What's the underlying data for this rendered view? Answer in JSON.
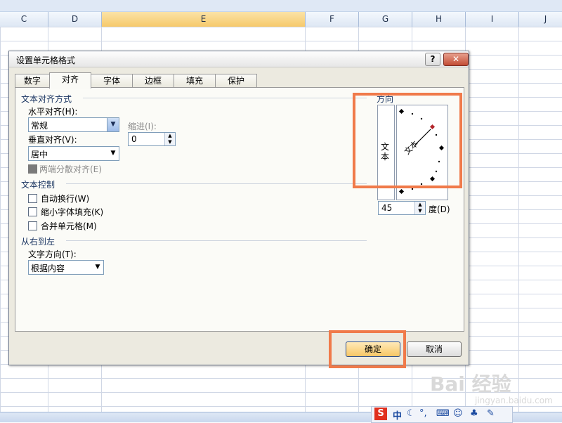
{
  "columns": [
    "C",
    "D",
    "E",
    "F",
    "G",
    "H",
    "I",
    "J"
  ],
  "dialog": {
    "title": "设置单元格格式",
    "help_glyph": "?",
    "close_glyph": "✕",
    "tabs": [
      "数字",
      "对齐",
      "字体",
      "边框",
      "填充",
      "保护"
    ],
    "active_tab": "对齐",
    "text_alignment": {
      "section_title": "文本对齐方式",
      "horizontal_label": "水平对齐(H):",
      "horizontal_value": "常规",
      "indent_label": "缩进(I):",
      "indent_value": "0",
      "vertical_label": "垂直对齐(V):",
      "vertical_value": "居中",
      "justify_distributed_label": "两端分散对齐(E)"
    },
    "text_control": {
      "section_title": "文本控制",
      "wrap_text_label": "自动换行(W)",
      "shrink_to_fit_label": "缩小字体填充(K)",
      "merge_cells_label": "合并单元格(M)"
    },
    "right_to_left": {
      "section_title": "从右到左",
      "text_direction_label": "文字方向(T):",
      "text_direction_value": "根据内容"
    },
    "orientation": {
      "section_title": "方向",
      "vertical_text": "文本",
      "dial_text": "文本",
      "degrees_value": "45",
      "degrees_label": "度(D)"
    },
    "buttons": {
      "ok": "确定",
      "cancel": "取消"
    }
  },
  "ime_toolbar": {
    "logo": "S",
    "mode": "中"
  },
  "watermark": {
    "text": "Bai 经验",
    "url": "jingyan.baidu.com"
  }
}
